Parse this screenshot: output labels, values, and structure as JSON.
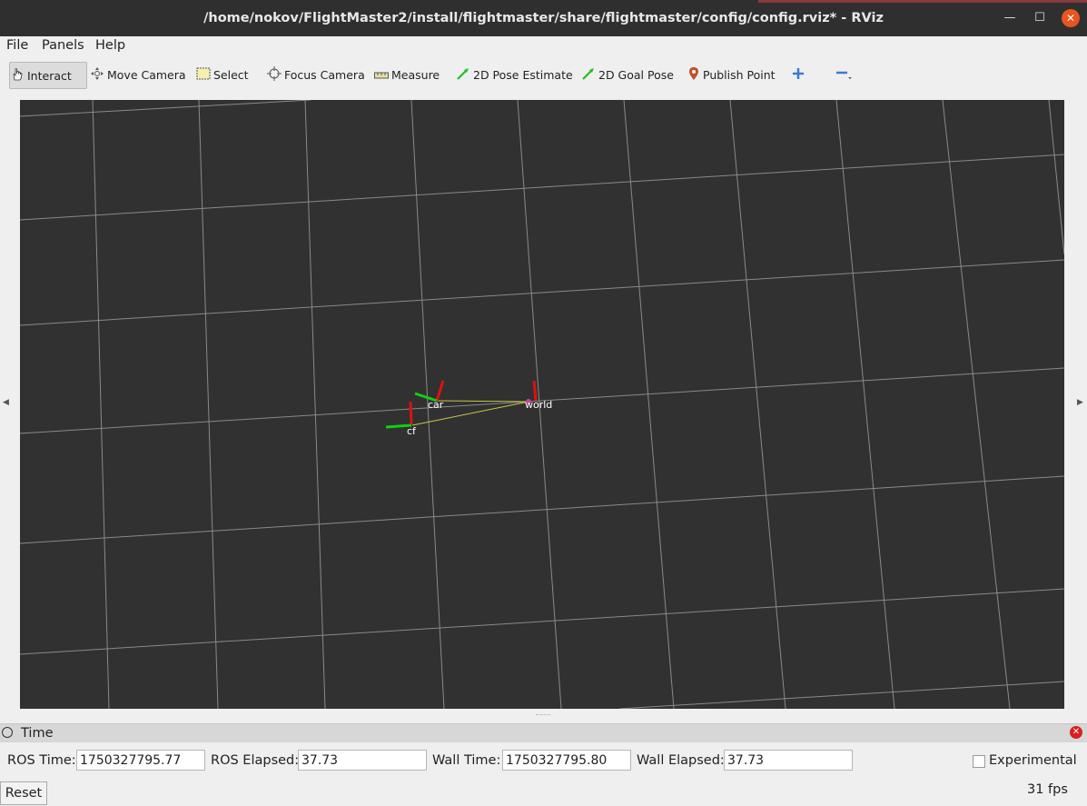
{
  "window": {
    "title": "/home/nokov/FlightMaster2/install/flightmaster/share/flightmaster/config/config.rviz* - RViz"
  },
  "menu": [
    {
      "label": "File"
    },
    {
      "label": "Panels"
    },
    {
      "label": "Help"
    }
  ],
  "toolbar": {
    "interact": "Interact",
    "move_camera": "Move Camera",
    "select": "Select",
    "focus_camera": "Focus Camera",
    "measure": "Measure",
    "pose_estimate": "2D Pose Estimate",
    "goal_pose": "2D Goal Pose",
    "publish_point": "Publish Point"
  },
  "frames": {
    "car": "car",
    "world": "world",
    "cf": "cf"
  },
  "time_panel": {
    "title": "Time",
    "ros_time_label": "ROS Time:",
    "ros_time": "1750327795.77",
    "ros_elapsed_label": "ROS Elapsed:",
    "ros_elapsed": "37.73",
    "wall_time_label": "Wall Time:",
    "wall_time": "1750327795.80",
    "wall_elapsed_label": "Wall Elapsed:",
    "wall_elapsed": "37.73",
    "experimental_label": "Experimental",
    "experimental_checked": false
  },
  "footer": {
    "reset_label": "Reset",
    "fps": "31 fps"
  },
  "colors": {
    "viewport_bg": "#313131",
    "grid": "#8a8a8a",
    "axis_x": "#e01010",
    "axis_y": "#10d010",
    "tf_line": "#c8c84a",
    "world_dot": "#d0409a"
  }
}
